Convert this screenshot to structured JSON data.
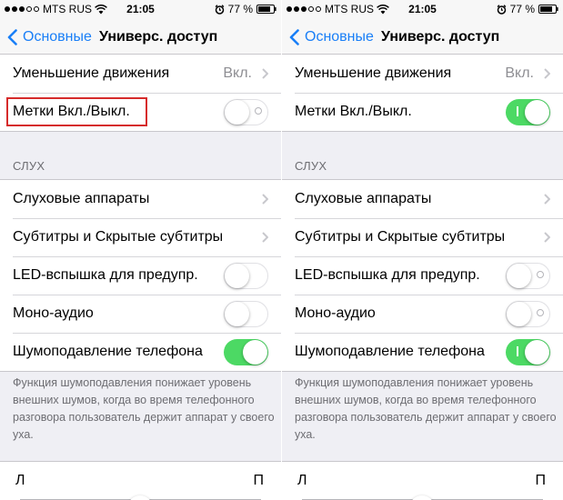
{
  "colors": {
    "accent": "#1a7ff7",
    "toggle_on": "#4cd964",
    "highlight": "#d62b2b"
  },
  "screens": [
    {
      "status": {
        "carrier": "MTS RUS",
        "time": "21:05",
        "battery": "77 %"
      },
      "nav": {
        "back_label": "Основные",
        "title": "Универс. доступ"
      },
      "top_rows": [
        {
          "label": "Уменьшение движения",
          "value": "Вкл.",
          "type": "chevron"
        },
        {
          "label": "Метки Вкл./Выкл.",
          "type": "toggle",
          "state": "off",
          "highlighted": true
        }
      ],
      "section_header": "СЛУХ",
      "hearing_rows": [
        {
          "label": "Слуховые аппараты",
          "type": "chevron"
        },
        {
          "label": "Субтитры и Скрытые субтитры",
          "type": "chevron"
        },
        {
          "label": "LED-вспышка для предупр.",
          "type": "toggle",
          "state": "off"
        },
        {
          "label": "Моно-аудио",
          "type": "toggle",
          "state": "off"
        },
        {
          "label": "Шумоподавление телефона",
          "type": "toggle",
          "state": "on"
        }
      ],
      "footer_note": "Функция шумоподавления понижает уровень внешних шумов, когда во время телефонного разговора пользователь держит аппарат у своего уха.",
      "balance": {
        "left_label": "Л",
        "right_label": "П"
      }
    },
    {
      "status": {
        "carrier": "MTS RUS",
        "time": "21:05",
        "battery": "77 %"
      },
      "nav": {
        "back_label": "Основные",
        "title": "Универс. доступ"
      },
      "top_rows": [
        {
          "label": "Уменьшение движения",
          "value": "Вкл.",
          "type": "chevron"
        },
        {
          "label": "Метки Вкл./Выкл.",
          "type": "toggle",
          "state": "on"
        }
      ],
      "section_header": "СЛУХ",
      "hearing_rows": [
        {
          "label": "Слуховые аппараты",
          "type": "chevron"
        },
        {
          "label": "Субтитры и Скрытые субтитры",
          "type": "chevron"
        },
        {
          "label": "LED-вспышка для предупр.",
          "type": "toggle",
          "state": "off"
        },
        {
          "label": "Моно-аудио",
          "type": "toggle",
          "state": "off"
        },
        {
          "label": "Шумоподавление телефона",
          "type": "toggle",
          "state": "on"
        }
      ],
      "footer_note": "Функция шумоподавления понижает уровень внешних шумов, когда во время телефонного разговора пользователь держит аппарат у своего уха.",
      "balance": {
        "left_label": "Л",
        "right_label": "П"
      }
    }
  ]
}
